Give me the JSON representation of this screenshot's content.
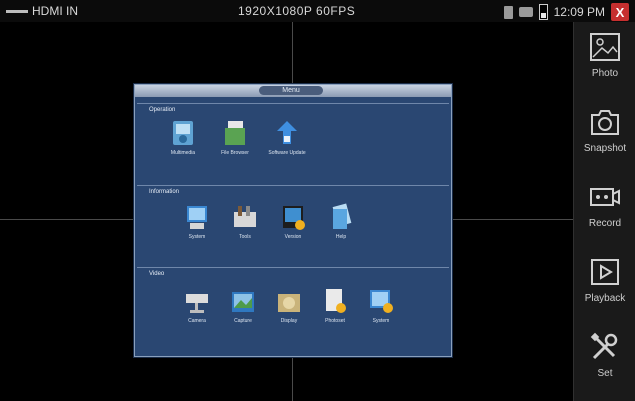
{
  "statusbar": {
    "source": "HDMI IN",
    "resolution": "1920X1080P 60FPS",
    "time": "12:09 PM",
    "close": "X"
  },
  "menu": {
    "title": "Menu",
    "sections": [
      {
        "title": "Operation",
        "items": [
          {
            "label": "Multimedia",
            "icon": "multimedia-icon"
          },
          {
            "label": "File Browser",
            "icon": "file-browser-icon"
          },
          {
            "label": "Software Update",
            "icon": "software-update-icon"
          }
        ]
      },
      {
        "title": "Information",
        "items": [
          {
            "label": "System",
            "icon": "system-icon"
          },
          {
            "label": "Tools",
            "icon": "tools-icon"
          },
          {
            "label": "Version",
            "icon": "version-icon"
          },
          {
            "label": "Help",
            "icon": "help-icon"
          }
        ]
      },
      {
        "title": "Video",
        "items": [
          {
            "label": "Camera",
            "icon": "camera-icon"
          },
          {
            "label": "Capture",
            "icon": "capture-icon"
          },
          {
            "label": "Display",
            "icon": "display-icon"
          },
          {
            "label": "Photoset",
            "icon": "photoset-icon"
          },
          {
            "label": "System",
            "icon": "video-system-icon"
          }
        ]
      }
    ]
  },
  "sidebar": {
    "buttons": [
      {
        "label": "Photo",
        "icon": "photo-icon"
      },
      {
        "label": "Snapshot",
        "icon": "snapshot-icon"
      },
      {
        "label": "Record",
        "icon": "record-icon"
      },
      {
        "label": "Playback",
        "icon": "playback-icon"
      },
      {
        "label": "Set",
        "icon": "settings-icon"
      }
    ]
  },
  "colors": {
    "menu_bg": "#2a4772",
    "close_button": "#c62f2f",
    "panel_bg": "#1a1a1a"
  }
}
